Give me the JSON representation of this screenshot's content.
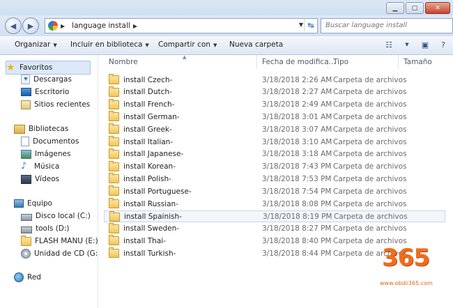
{
  "window": {
    "buttons": [
      {
        "name": "minimize-button",
        "glyph": "▁"
      },
      {
        "name": "maximize-button",
        "glyph": "▢"
      },
      {
        "name": "close-button",
        "glyph": "✕"
      }
    ]
  },
  "address_bar": {
    "path": [
      "language install"
    ],
    "back_glyph": "◀",
    "forward_glyph": "▶",
    "refresh_glyph": "↹"
  },
  "search": {
    "placeholder": "Buscar language install"
  },
  "toolbar": {
    "organize": "Organizar",
    "include_library": "Incluir en biblioteca",
    "share_with": "Compartir con",
    "new_folder": "Nueva carpeta"
  },
  "sidebar": {
    "favorites": {
      "label": "Favoritos",
      "items": [
        {
          "label": "Descargas",
          "icon": "downloads-icon"
        },
        {
          "label": "Escritorio",
          "icon": "desktop-icon"
        },
        {
          "label": "Sitios recientes",
          "icon": "recent-places-icon"
        }
      ]
    },
    "libraries": {
      "label": "Bibliotecas",
      "items": [
        {
          "label": "Documentos",
          "icon": "documents-icon"
        },
        {
          "label": "Imágenes",
          "icon": "pictures-icon"
        },
        {
          "label": "Música",
          "icon": "music-icon"
        },
        {
          "label": "Vídeos",
          "icon": "videos-icon"
        }
      ]
    },
    "computer": {
      "label": "Equipo",
      "items": [
        {
          "label": "Disco local (C:)",
          "icon": "local-disk-icon"
        },
        {
          "label": "tools (D:)",
          "icon": "disk-icon"
        },
        {
          "label": "FLASH MANU (E:)",
          "icon": "folder-icon"
        },
        {
          "label": "Unidad de CD (G:)",
          "icon": "cd-drive-icon"
        }
      ]
    },
    "network": {
      "label": "Red"
    }
  },
  "columns": {
    "name": "Nombre",
    "date": "Fecha de modifica...",
    "type": "Tipo",
    "size": "Tamaño"
  },
  "files": [
    {
      "name": "install Czech-",
      "date": "3/18/2018 2:26 AM",
      "type": "Carpeta de archivos"
    },
    {
      "name": "install Dutch-",
      "date": "3/18/2018 2:27 AM",
      "type": "Carpeta de archivos"
    },
    {
      "name": "install French-",
      "date": "3/18/2018 2:49 AM",
      "type": "Carpeta de archivos"
    },
    {
      "name": "install German-",
      "date": "3/18/2018 3:01 AM",
      "type": "Carpeta de archivos"
    },
    {
      "name": "install Greek-",
      "date": "3/18/2018 3:07 AM",
      "type": "Carpeta de archivos"
    },
    {
      "name": "install Italian-",
      "date": "3/18/2018 3:10 AM",
      "type": "Carpeta de archivos"
    },
    {
      "name": "install Japanese-",
      "date": "3/18/2018 3:18 AM",
      "type": "Carpeta de archivos"
    },
    {
      "name": "install Korean-",
      "date": "3/18/2018 7:43 PM",
      "type": "Carpeta de archivos"
    },
    {
      "name": "install Polish-",
      "date": "3/18/2018 7:53 PM",
      "type": "Carpeta de archivos"
    },
    {
      "name": "install Portuguese-",
      "date": "3/18/2018 7:54 PM",
      "type": "Carpeta de archivos"
    },
    {
      "name": "install Russian-",
      "date": "3/18/2018 8:08 PM",
      "type": "Carpeta de archivos"
    },
    {
      "name": "install Spainish-",
      "date": "3/18/2018 8:19 PM",
      "type": "Carpeta de archivos"
    },
    {
      "name": "install Sweden-",
      "date": "3/18/2018 8:27 PM",
      "type": "Carpeta de archivos"
    },
    {
      "name": "install Thai-",
      "date": "3/18/2018 8:40 PM",
      "type": "Carpeta de archivos"
    },
    {
      "name": "install Turkish-",
      "date": "3/18/2018 8:44 PM",
      "type": "Carpeta de archivos"
    }
  ],
  "highlighted_row": 11,
  "watermark": {
    "number": "365",
    "url": "www.obdii365.com"
  }
}
